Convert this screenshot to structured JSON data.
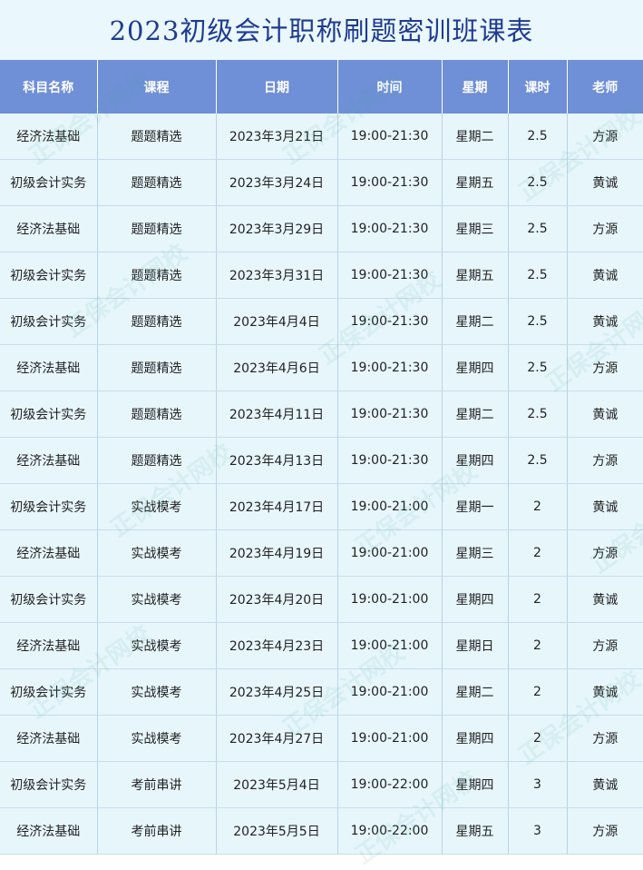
{
  "title": "2023初级会计职称刷题密训班课表",
  "columns": [
    "科目名称",
    "课程",
    "日期",
    "时间",
    "星期",
    "课时",
    "老师"
  ],
  "rows": [
    [
      "经济法基础",
      "题题精选",
      "2023年3月21日",
      "19:00-21:30",
      "星期二",
      "2.5",
      "方源"
    ],
    [
      "初级会计实务",
      "题题精选",
      "2023年3月24日",
      "19:00-21:30",
      "星期五",
      "2.5",
      "黄诚"
    ],
    [
      "经济法基础",
      "题题精选",
      "2023年3月29日",
      "19:00-21:30",
      "星期三",
      "2.5",
      "方源"
    ],
    [
      "初级会计实务",
      "题题精选",
      "2023年3月31日",
      "19:00-21:30",
      "星期五",
      "2.5",
      "黄诚"
    ],
    [
      "初级会计实务",
      "题题精选",
      "2023年4月4日",
      "19:00-21:30",
      "星期二",
      "2.5",
      "黄诚"
    ],
    [
      "经济法基础",
      "题题精选",
      "2023年4月6日",
      "19:00-21:30",
      "星期四",
      "2.5",
      "方源"
    ],
    [
      "初级会计实务",
      "题题精选",
      "2023年4月11日",
      "19:00-21:30",
      "星期二",
      "2.5",
      "黄诚"
    ],
    [
      "经济法基础",
      "题题精选",
      "2023年4月13日",
      "19:00-21:30",
      "星期四",
      "2.5",
      "方源"
    ],
    [
      "初级会计实务",
      "实战模考",
      "2023年4月17日",
      "19:00-21:00",
      "星期一",
      "2",
      "黄诚"
    ],
    [
      "经济法基础",
      "实战模考",
      "2023年4月19日",
      "19:00-21:00",
      "星期三",
      "2",
      "方源"
    ],
    [
      "初级会计实务",
      "实战模考",
      "2023年4月20日",
      "19:00-21:00",
      "星期四",
      "2",
      "黄诚"
    ],
    [
      "经济法基础",
      "实战模考",
      "2023年4月23日",
      "19:00-21:00",
      "星期日",
      "2",
      "方源"
    ],
    [
      "初级会计实务",
      "实战模考",
      "2023年4月25日",
      "19:00-21:00",
      "星期二",
      "2",
      "黄诚"
    ],
    [
      "经济法基础",
      "实战模考",
      "2023年4月27日",
      "19:00-21:00",
      "星期四",
      "2",
      "方源"
    ],
    [
      "初级会计实务",
      "考前串讲",
      "2023年5月4日",
      "19:00-22:00",
      "星期四",
      "3",
      "黄诚"
    ],
    [
      "经济法基础",
      "考前串讲",
      "2023年5月5日",
      "19:00-22:00",
      "星期五",
      "3",
      "方源"
    ]
  ],
  "watermark": "正保会计网校",
  "colors": {
    "title_text": "#1f3b8f",
    "header_bg": "#6f8fd6",
    "row_bg": "#e7f6fb"
  }
}
